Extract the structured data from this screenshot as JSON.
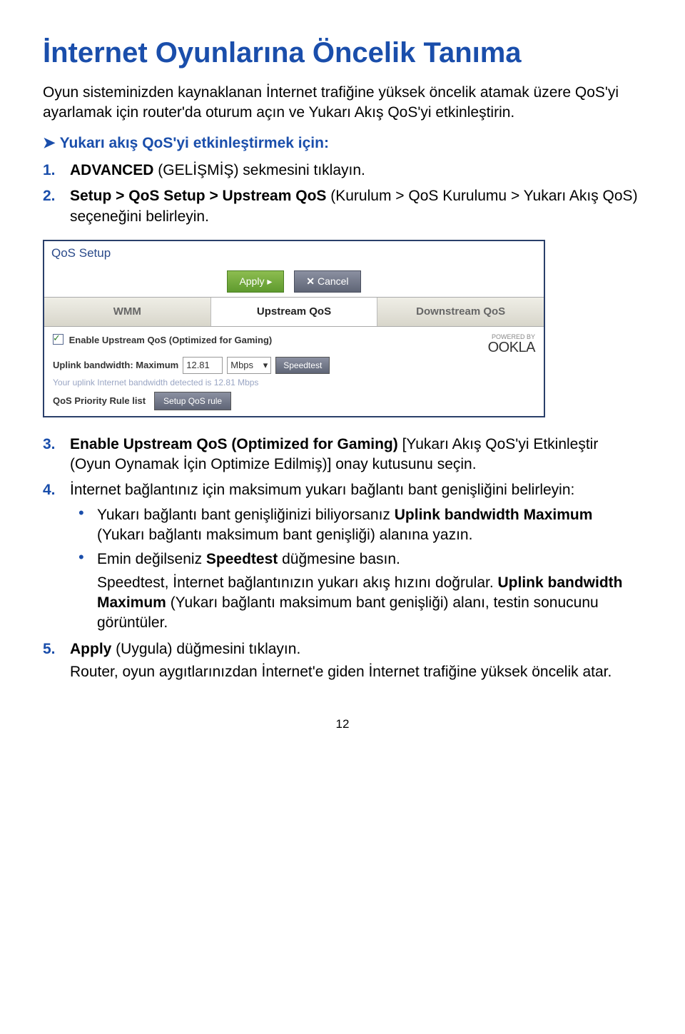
{
  "title": "İnternet Oyunlarına Öncelik Tanıma",
  "intro": "Oyun sisteminizden kaynaklanan İnternet trafiğine yüksek öncelik atamak üzere QoS'yi ayarlamak için router'da oturum açın ve Yukarı Akış QoS'yi etkinleştirin.",
  "procHead": "Yukarı akış QoS'yi etkinleştirmek için:",
  "steps": {
    "1": {
      "pre": "ADVANCED",
      "post": " (GELİŞMİŞ) sekmesini tıklayın."
    },
    "2": {
      "pre": "Setup > QoS Setup > Upstream QoS",
      "post": " (Kurulum > QoS Kurulumu > Yukarı Akış QoS) seçeneğini belirleyin."
    },
    "3": {
      "pre": "Enable Upstream QoS (Optimized for Gaming)",
      "post": " [Yukarı Akış QoS'yi Etkinleştir (Oyun Oynamak İçin Optimize Edilmiş)] onay kutusunu seçin."
    },
    "4": {
      "lead": "İnternet bağlantınız için maksimum yukarı bağlantı bant genişliğini belirleyin:",
      "b1a": "Yukarı bağlantı bant genişliğinizi biliyorsanız ",
      "b1b": "Uplink bandwidth Maximum",
      "b1c": " (Yukarı bağlantı maksimum bant genişliği) alanına yazın.",
      "b2a": "Emin değilseniz ",
      "b2b": "Speedtest",
      "b2c": " düğmesine basın.",
      "speed_desc": "Speedtest, İnternet bağlantınızın yukarı akış hızını doğrular. ",
      "speed_bold": "Uplink bandwidth Maximum",
      "speed_tail": " (Yukarı bağlantı maksimum bant genişliği) alanı, testin sonucunu görüntüler."
    },
    "5": {
      "pre": "Apply",
      "post": " (Uygula) düğmesini tıklayın.",
      "after": "Router, oyun aygıtlarınızdan İnternet'e giden İnternet trafiğine yüksek öncelik atar."
    }
  },
  "screenshot": {
    "title": "QoS Setup",
    "apply": "Apply ▸",
    "cancel": "Cancel",
    "tabs": {
      "wmm": "WMM",
      "upstream": "Upstream QoS",
      "downstream": "Downstream QoS"
    },
    "enable": "Enable Upstream QoS (Optimized for Gaming)",
    "powered": "POWERED BY",
    "ookla": "OOKLA",
    "uplink_label": "Uplink bandwidth: Maximum",
    "uplink_value": "12.81",
    "uplink_unit": "Mbps",
    "speedtest": "Speedtest",
    "detected": "Your uplink Internet bandwidth detected is 12.81 Mbps",
    "priority": "QoS Priority Rule list",
    "setup_rule": "Setup QoS rule"
  },
  "pageNum": "12"
}
